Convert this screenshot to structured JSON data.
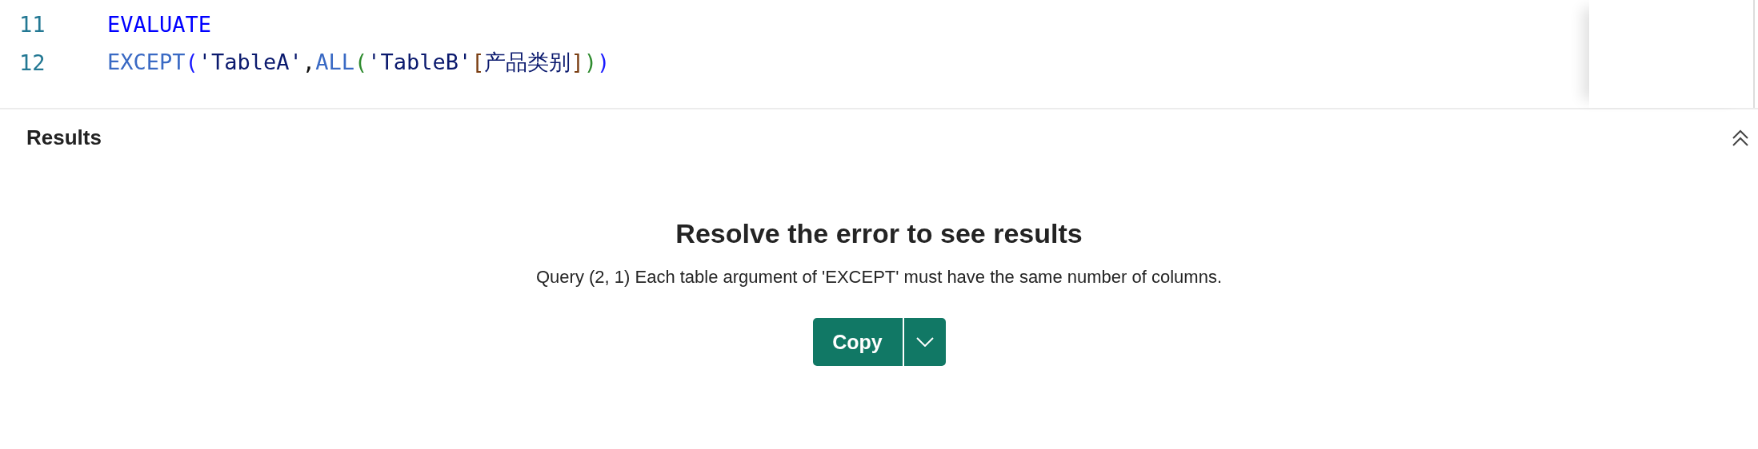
{
  "editor": {
    "lines": [
      {
        "number": "11",
        "tokens": [
          {
            "kind": "keyword",
            "text": "EVALUATE"
          }
        ]
      },
      {
        "number": "12",
        "tokens": [
          {
            "kind": "function",
            "text": "EXCEPT"
          },
          {
            "kind": "paren1",
            "text": "("
          },
          {
            "kind": "string",
            "text": "'TableA'"
          },
          {
            "kind": "punct",
            "text": ","
          },
          {
            "kind": "function",
            "text": "ALL"
          },
          {
            "kind": "paren2",
            "text": "("
          },
          {
            "kind": "string",
            "text": "'TableB'"
          },
          {
            "kind": "bracket",
            "text": "["
          },
          {
            "kind": "string",
            "text": "产品类别"
          },
          {
            "kind": "bracket",
            "text": "]"
          },
          {
            "kind": "paren2",
            "text": ")"
          },
          {
            "kind": "paren1",
            "text": ")"
          }
        ]
      }
    ]
  },
  "results": {
    "title": "Results",
    "expanded": true,
    "heading": "Resolve the error to see results",
    "message": "Query (2, 1) Each table argument of 'EXCEPT' must have the same number of columns.",
    "copy_button": "Copy"
  }
}
